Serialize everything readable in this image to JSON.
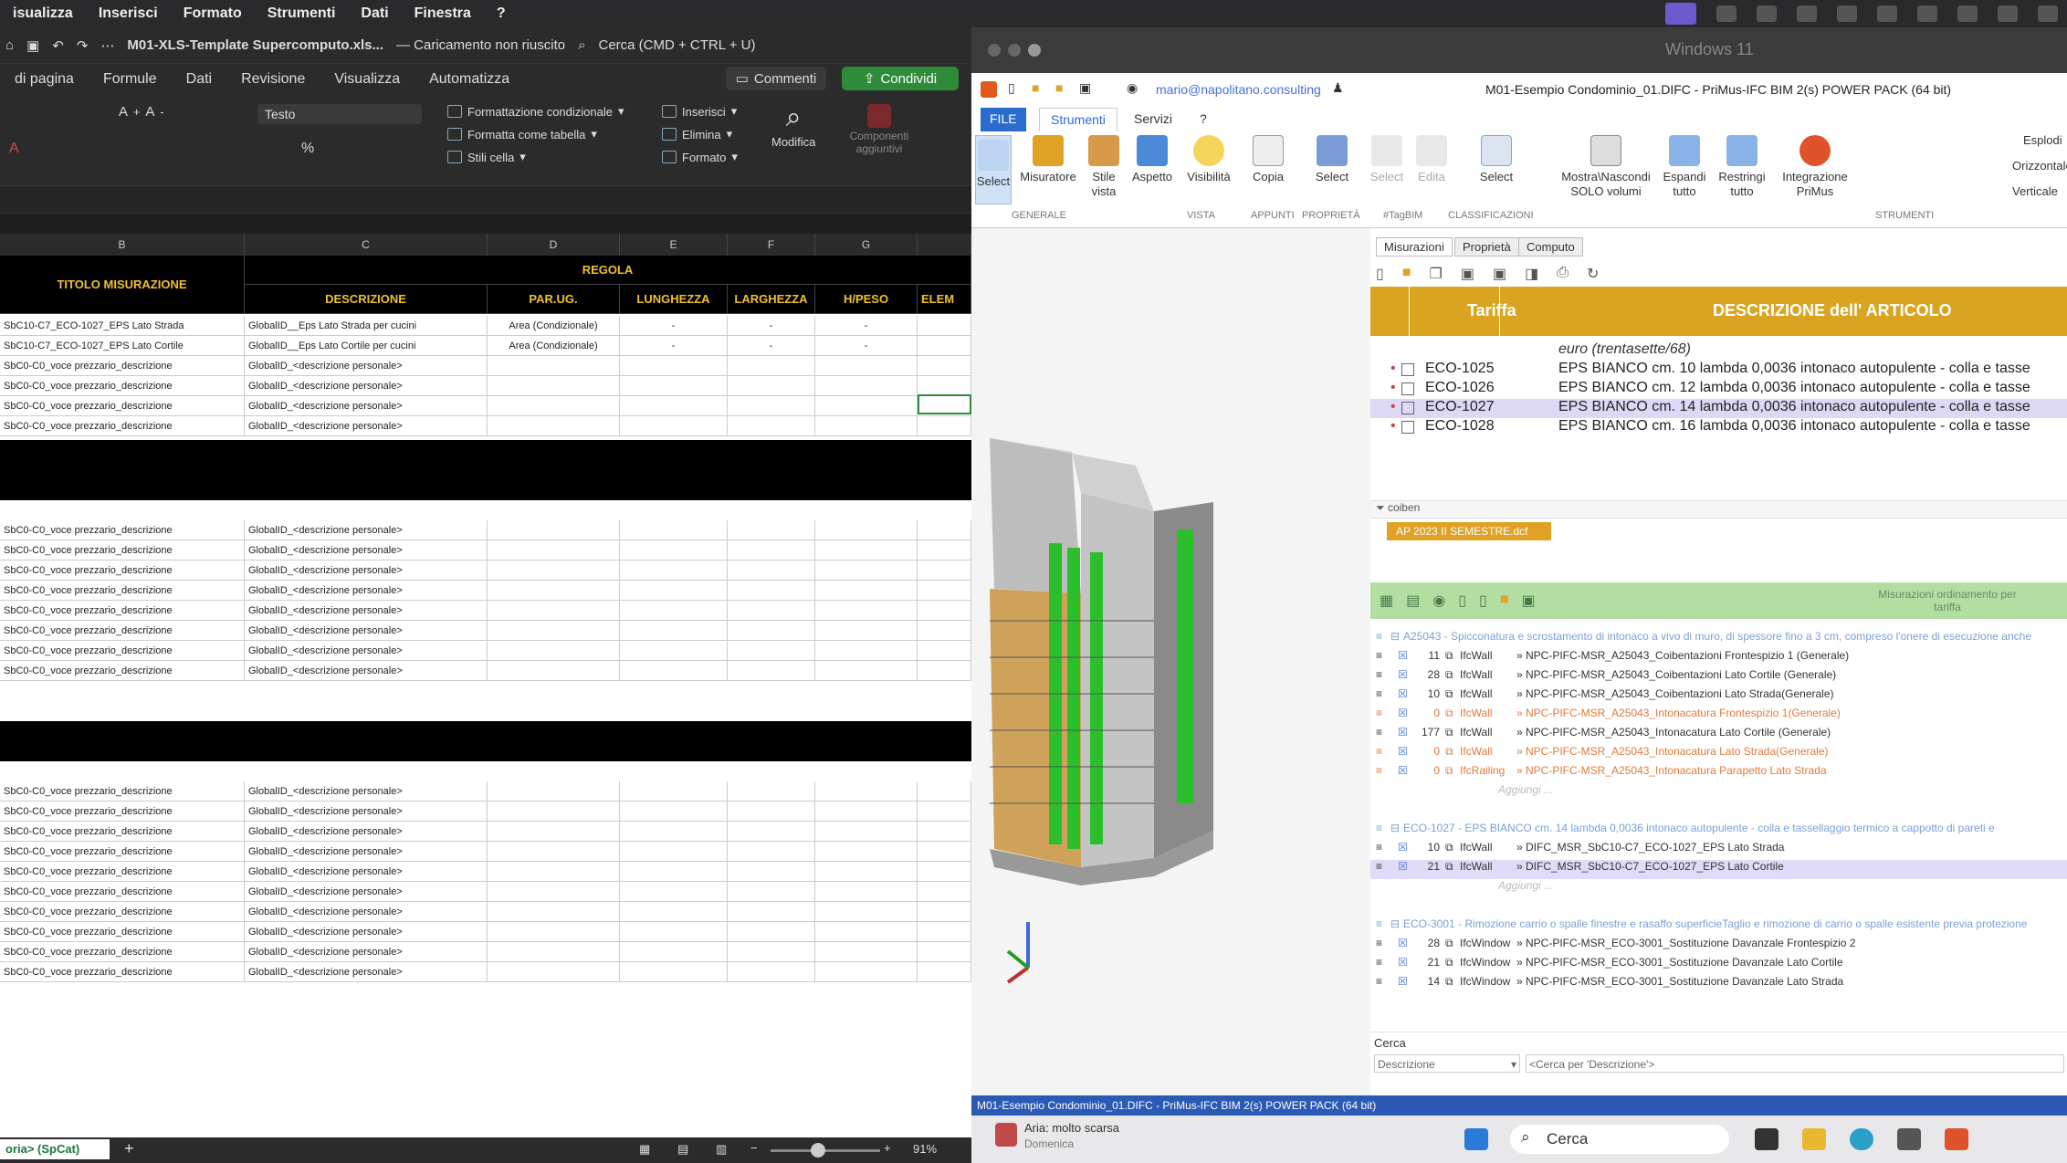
{
  "mac_menu": [
    "isualizza",
    "Inserisci",
    "Formato",
    "Strumenti",
    "Dati",
    "Finestra",
    "?"
  ],
  "excel": {
    "filename": "M01-XLS-Template Supercomputo.xls...",
    "load_status": "— Caricamento non riuscito",
    "search_placeholder": "Cerca (CMD + CTRL + U)",
    "comments_label": "Commenti",
    "share_label": "Condividi",
    "ribbon_tabs": [
      "di pagina",
      "Formule",
      "Dati",
      "Revisione",
      "Visualizza",
      "Automatizza"
    ],
    "font_name": "Testo",
    "ribbon": {
      "cond_format": "Formattazione condizionale",
      "format_table": "Formatta come tabella",
      "cell_styles": "Stili cella",
      "insert": "Inserisci",
      "delete": "Elimina",
      "format": "Formato",
      "edit": "Modifica",
      "addins": "Componenti aggiuntivi",
      "percent": "%"
    },
    "col_letters": [
      "B",
      "C",
      "D",
      "E",
      "F",
      "G"
    ],
    "header": {
      "titolo": "TITOLO MISURAZIONE",
      "regola": "REGOLA",
      "descrizione": "DESCRIZIONE",
      "parug": "PAR.UG.",
      "lunghezza": "LUNGHEZZA",
      "larghezza": "LARGHEZZA",
      "hpeso": "H/PESO",
      "elem": "ELEM"
    },
    "rows_a": [
      {
        "b": "SbC10-C7_ECO-1027_EPS Lato Strada",
        "c": "GlobalID__Eps Lato Strada per cucini",
        "d": "Area (Condizionale)",
        "e": "-",
        "f": "-",
        "g": "-"
      },
      {
        "b": "SbC10-C7_ECO-1027_EPS Lato Cortile",
        "c": "GlobalID__Eps Lato Cortile per cucini",
        "d": "Area (Condizionale)",
        "e": "-",
        "f": "-",
        "g": "-"
      },
      {
        "b": "SbC0-C0_voce prezzario_descrizione",
        "c": "GlobalID_<descrizione personale>",
        "d": "",
        "e": "",
        "f": "",
        "g": ""
      },
      {
        "b": "SbC0-C0_voce prezzario_descrizione",
        "c": "GlobalID_<descrizione personale>",
        "d": "",
        "e": "",
        "f": "",
        "g": ""
      },
      {
        "b": "SbC0-C0_voce prezzario_descrizione",
        "c": "GlobalID_<descrizione personale>",
        "d": "",
        "e": "",
        "f": "",
        "g": ""
      },
      {
        "b": "SbC0-C0_voce prezzario_descrizione",
        "c": "GlobalID_<descrizione personale>",
        "d": "",
        "e": "",
        "f": "",
        "g": ""
      }
    ],
    "rows_b": [
      {
        "b": "SbC0-C0_voce prezzario_descrizione",
        "c": "GlobalID_<descrizione personale>"
      },
      {
        "b": "SbC0-C0_voce prezzario_descrizione",
        "c": "GlobalID_<descrizione personale>"
      },
      {
        "b": "SbC0-C0_voce prezzario_descrizione",
        "c": "GlobalID_<descrizione personale>"
      },
      {
        "b": "SbC0-C0_voce prezzario_descrizione",
        "c": "GlobalID_<descrizione personale>"
      },
      {
        "b": "SbC0-C0_voce prezzario_descrizione",
        "c": "GlobalID_<descrizione personale>"
      },
      {
        "b": "SbC0-C0_voce prezzario_descrizione",
        "c": "GlobalID_<descrizione personale>"
      },
      {
        "b": "SbC0-C0_voce prezzario_descrizione",
        "c": "GlobalID_<descrizione personale>"
      },
      {
        "b": "SbC0-C0_voce prezzario_descrizione",
        "c": "GlobalID_<descrizione personale>"
      }
    ],
    "rows_c": [
      {
        "b": "SbC0-C0_voce prezzario_descrizione",
        "c": "GlobalID_<descrizione personale>"
      },
      {
        "b": "SbC0-C0_voce prezzario_descrizione",
        "c": "GlobalID_<descrizione personale>"
      },
      {
        "b": "SbC0-C0_voce prezzario_descrizione",
        "c": "GlobalID_<descrizione personale>"
      },
      {
        "b": "SbC0-C0_voce prezzario_descrizione",
        "c": "GlobalID_<descrizione personale>"
      },
      {
        "b": "SbC0-C0_voce prezzario_descrizione",
        "c": "GlobalID_<descrizione personale>"
      },
      {
        "b": "SbC0-C0_voce prezzario_descrizione",
        "c": "GlobalID_<descrizione personale>"
      },
      {
        "b": "SbC0-C0_voce prezzario_descrizione",
        "c": "GlobalID_<descrizione personale>"
      },
      {
        "b": "SbC0-C0_voce prezzario_descrizione",
        "c": "GlobalID_<descrizione personale>"
      },
      {
        "b": "SbC0-C0_voce prezzario_descrizione",
        "c": "GlobalID_<descrizione personale>"
      },
      {
        "b": "SbC0-C0_voce prezzario_descrizione",
        "c": "GlobalID_<descrizione personale>"
      }
    ],
    "sheet_tab": "oria> (SpCat)",
    "zoom": "91%"
  },
  "primus": {
    "vm_title": "Windows 11",
    "email": "mario@napolitano.consulting",
    "title": "M01-Esempio Condominio_01.DIFC - PriMus-IFC  BIM 2(s) POWER PACK (64 bit)",
    "tabs": {
      "file": "FILE",
      "strumenti": "Strumenti",
      "servizi": "Servizi",
      "help": "?"
    },
    "ribbon": [
      {
        "label": "Select"
      },
      {
        "label": "Misuratore"
      },
      {
        "label": "Stile vista"
      },
      {
        "label": "Aspetto"
      },
      {
        "label": "Visibilità"
      },
      {
        "label": "Copia"
      },
      {
        "label": "Select"
      },
      {
        "label": "Select"
      },
      {
        "label": "Edita"
      },
      {
        "label": "Select"
      },
      {
        "label": "Mostra\\Nascondi SOLO volumi"
      },
      {
        "label": "Espandi tutto"
      },
      {
        "label": "Restringi tutto"
      },
      {
        "label": "Integrazione PriMus"
      }
    ],
    "ribbon_right": {
      "explode": "Esplodi",
      "horizontal": "Orizzontale",
      "vertical": "Verticale"
    },
    "groups": {
      "generale": "GENERALE",
      "vista": "VISTA",
      "appunti": "APPUNTI",
      "proprieta": "PROPRIETÀ",
      "tagbim": "#TagBIM",
      "classificazioni": "CLASSIFICAZIONI",
      "strumenti": "STRUMENTI"
    },
    "pane_tabs": [
      "Misurazioni",
      "Proprietà",
      "Computo"
    ],
    "col_tariffa": "Tariffa",
    "col_descr": "DESCRIZIONE dell' ARTICOLO",
    "euro_text": "euro (trentasette/68)",
    "articles": [
      {
        "code": "ECO-1025",
        "desc": "EPS BIANCO cm. 10 lambda 0,0036 intonaco autopulente - colla e tasse"
      },
      {
        "code": "ECO-1026",
        "desc": "EPS BIANCO cm. 12 lambda 0,0036 intonaco autopulente - colla e tasse"
      },
      {
        "code": "ECO-1027",
        "desc": "EPS BIANCO cm. 14 lambda 0,0036 intonaco autopulente - colla e tasse"
      },
      {
        "code": "ECO-1028",
        "desc": "EPS BIANCO cm. 16 lambda 0,0036 intonaco autopulente - colla e tasse"
      }
    ],
    "filter_text": "coiben",
    "dcf_label": "AP 2023 II SEMESTRE.dcf",
    "meas_header": "Misurazioni ordinamento per tariffa",
    "groups_meas": [
      {
        "title": "A25043 - Spicconatura e scrostamento di intonaco a vivo di muro, di spessore fino a 3 cm, compreso l'onere di esecuzione anche",
        "rows": [
          {
            "n": "11",
            "type": "IfcWall",
            "name": "» NPC-PIFC-MSR_A25043_Coibentazioni Frontespizio 1 (Generale)",
            "orange": false
          },
          {
            "n": "28",
            "type": "IfcWall",
            "name": "» NPC-PIFC-MSR_A25043_Coibentazioni Lato Cortile (Generale)",
            "orange": false
          },
          {
            "n": "10",
            "type": "IfcWall",
            "name": "» NPC-PIFC-MSR_A25043_Coibentazioni Lato Strada(Generale)",
            "orange": false
          },
          {
            "n": "0",
            "type": "IfcWall",
            "name": "» NPC-PIFC-MSR_A25043_Intonacatura Frontespizio 1(Generale)",
            "orange": true
          },
          {
            "n": "177",
            "type": "IfcWall",
            "name": "» NPC-PIFC-MSR_A25043_Intonacatura Lato Cortile (Generale)",
            "orange": false
          },
          {
            "n": "0",
            "type": "IfcWall",
            "name": "» NPC-PIFC-MSR_A25043_Intonacatura Lato Strada(Generale)",
            "orange": true
          },
          {
            "n": "0",
            "type": "IfcRailing",
            "name": "» NPC-PIFC-MSR_A25043_Intonacatura Parapetto Lato Strada",
            "orange": true
          }
        ]
      },
      {
        "title": "ECO-1027 - EPS BIANCO cm. 14 lambda 0,0036 intonaco autopulente - colla e tassellaggio termico a cappotto di pareti e",
        "rows": [
          {
            "n": "10",
            "type": "IfcWall",
            "name": "» DIFC_MSR_SbC10-C7_ECO-1027_EPS Lato Strada",
            "orange": false
          },
          {
            "n": "21",
            "type": "IfcWall",
            "name": "» DIFC_MSR_SbC10-C7_ECO-1027_EPS Lato Cortile",
            "orange": false
          }
        ]
      },
      {
        "title": "ECO-3001 - Rimozione carrio o spalle finestre e rasaffo superficieTaglio e rimozione di carrio o spalle esistente previa protezione",
        "rows": [
          {
            "n": "28",
            "type": "IfcWindow",
            "name": "» NPC-PIFC-MSR_ECO-3001_Sostituzione Davanzale Frontespizio 2",
            "orange": false
          },
          {
            "n": "21",
            "type": "IfcWindow",
            "name": "» NPC-PIFC-MSR_ECO-3001_Sostituzione Davanzale Lato Cortile",
            "orange": false
          },
          {
            "n": "14",
            "type": "IfcWindow",
            "name": "» NPC-PIFC-MSR_ECO-3001_Sostituzione Davanzale Lato Strada",
            "orange": false
          }
        ]
      }
    ],
    "add_label": "Aggiungi ...",
    "search_label": "Cerca",
    "search_field": "Descrizione",
    "search_placeholder": "<Cerca per 'Descrizione'>",
    "status": "M01-Esempio Condominio_01.DIFC - PriMus-IFC  BIM 2(s) POWER PACK (64 bit)"
  },
  "taskbar": {
    "weather": "Aria: molto scarsa",
    "weather_sub": "Domenica",
    "search": "Cerca"
  }
}
